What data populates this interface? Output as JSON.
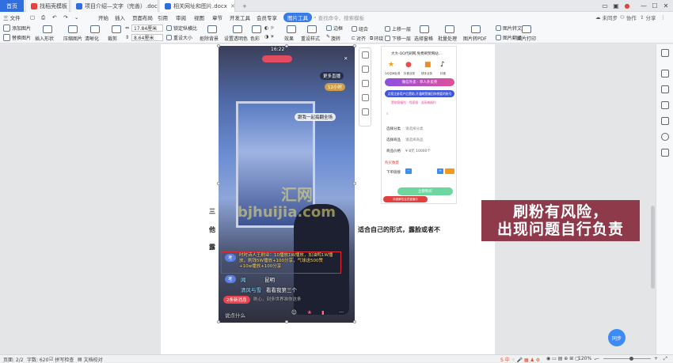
{
  "titlebar": {
    "home_tab": "首页",
    "tabs": [
      {
        "label": "找稻壳模板",
        "color": "#e8433b"
      },
      {
        "label": "项目介绍—文字（完善）.docx",
        "color": "#2f6fe0"
      },
      {
        "label": "相关网址和图片.docx",
        "color": "#2f6fe0"
      }
    ],
    "login_label": "未同步",
    "collab_label": "协作",
    "share_label": "分享"
  },
  "menubar": {
    "file_label": "三 文件",
    "items": [
      "开始",
      "插入",
      "页面布局",
      "引用",
      "审阅",
      "视图",
      "章节",
      "开发工具",
      "会员专享"
    ],
    "active_item": "图片工具",
    "search_placeholder": "查找命令、搜索模板"
  },
  "ribbon": {
    "add_image": "添加图片",
    "replace_image": "替换图片",
    "insert_shape": "插入形状",
    "compress": "压缩图片",
    "clarify": "清晰化",
    "crop": "裁剪",
    "width_value": "17.84厘米",
    "height_value": "8.64厘米",
    "lock_ratio": "锁定纵横比",
    "reset_size": "重设大小",
    "cutout": "抠除背景",
    "transparent": "设置透明色",
    "color": "色彩",
    "effect": "效果",
    "reset_style": "重设样式",
    "border": "边框",
    "rotate": "旋转",
    "align": "对齐",
    "group": "组合",
    "wrap": "环绕",
    "bring_forward": "上移一层",
    "send_backward": "下移一层",
    "select_pane": "选择窗格",
    "batch": "批量处理",
    "to_pdf": "图片转PDF",
    "to_text": "图片转文字",
    "translate": "图片翻译",
    "print": "图片打印"
  },
  "document": {
    "line1": "三",
    "line2_left": "他",
    "line2_right": "适合自己的形式，露脸或者不",
    "line3": "露"
  },
  "live_screenshot": {
    "time": "16:22",
    "more_live": "更多直播",
    "hours_rank": "12小时",
    "float_banner": "跟我一起捣翻全场",
    "comments": [
      {
        "badge": "考"
      },
      {
        "badge": "考"
      }
    ],
    "highlighted_comment": "时时诗人王刷业：10播放1W播放，加油鸭1W播放，刷钱5W播放+100分享，气球送500赞+10w播放+100分享",
    "comment_user1": "闻",
    "comment_text1": "昆明",
    "comment_user2": "清风与雪",
    "comment_text2": "看看我第三个",
    "new_messages": "2条新消息",
    "tail_text": "刷心，刻多世界准你这条",
    "say_something": "说点什么"
  },
  "phone_screenshot": {
    "header": "大大-QQ代刷网,免费刷赞网站...",
    "apps": [
      "QQ空间业务",
      "抖音业务",
      "快手业务",
      "抖音"
    ],
    "banner": "微信外卖 · 单人外卖券",
    "notice": "点我注册用户后赞助,开通刷赞赚回你想要的账号",
    "notice2": "赞助赛福利 · 找客服 · 送高端福利",
    "select_label": "选择分类",
    "select_value": "请选择分类",
    "select_goods": "选择商品",
    "goods_value": "请选择商品",
    "price_label": "商品价格",
    "price_value": "¥ 8元 10000个",
    "buy_label": "购买数量",
    "order_label": "下单链接",
    "submit": "立即购买",
    "alert": "抖音解答会员直播中"
  },
  "warning": {
    "line1": "刷粉有风险，",
    "line2": "出现问题自行负责"
  },
  "watermark": "bjhuijia.com",
  "statusbar": {
    "page": "页面: 2/2",
    "words": "字数: 620",
    "spell": "拼写检查",
    "doc_check": "文档校对",
    "zoom": "120%"
  },
  "fab_label": "同步"
}
